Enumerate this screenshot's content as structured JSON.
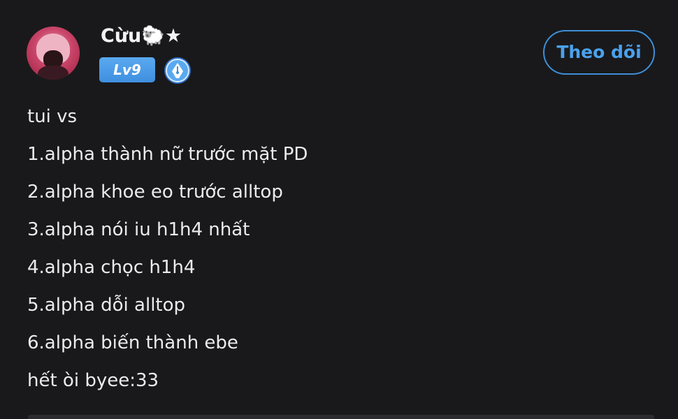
{
  "post": {
    "author": {
      "name": "Cừu🐑★",
      "level": "Lv9"
    },
    "follow_label": "Theo dõi",
    "lines": [
      "tui vs",
      "1.alpha thành nữ trước mặt PD",
      "2.alpha khoe eo trước alltop",
      "3.alpha nói iu h1h4 nhất",
      "4.alpha chọc h1h4",
      "5.alpha dỗi alltop",
      "6.alpha biến thành ebe",
      "hết òi byee:33"
    ]
  },
  "icons": {
    "creator_badge": "pen-nib-icon"
  },
  "colors": {
    "background": "#19191b",
    "text": "#ebebed",
    "accent": "#4aa2ee",
    "level_badge": "#4a9be8"
  }
}
